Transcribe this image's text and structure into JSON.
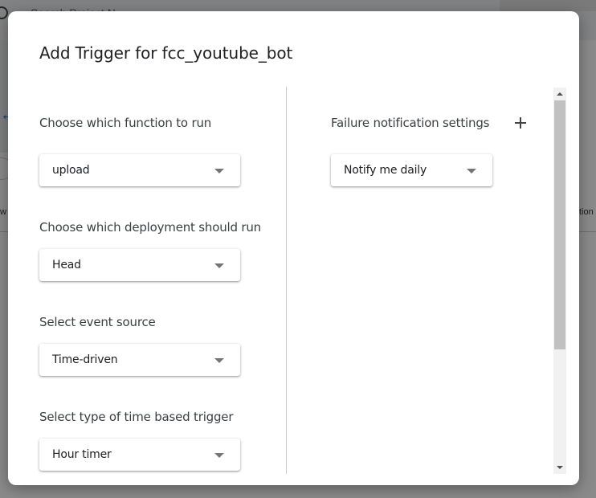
{
  "background": {
    "search_text": "Search Project N",
    "left_col_fragment": "w",
    "right_col_fragment": "tion"
  },
  "dialog": {
    "title": "Add Trigger for fcc_youtube_bot",
    "left": {
      "function_label": "Choose which function to run",
      "function_value": "upload",
      "deployment_label": "Choose which deployment should run",
      "deployment_value": "Head",
      "event_source_label": "Select event source",
      "event_source_value": "Time-driven",
      "time_trigger_label": "Select type of time based trigger",
      "time_trigger_value": "Hour timer"
    },
    "right": {
      "failure_label": "Failure notification settings",
      "failure_value": "Notify me daily"
    }
  },
  "colors": {
    "scrim": "#000000",
    "dialog_bg": "#ffffff",
    "text": "#3c4043",
    "caret": "#757575",
    "scroll_thumb": "#c1c1c1"
  },
  "icons": {
    "add": "plus-icon",
    "dropdown": "caret-down-icon",
    "back": "arrow-back-icon",
    "search": "search-icon"
  }
}
